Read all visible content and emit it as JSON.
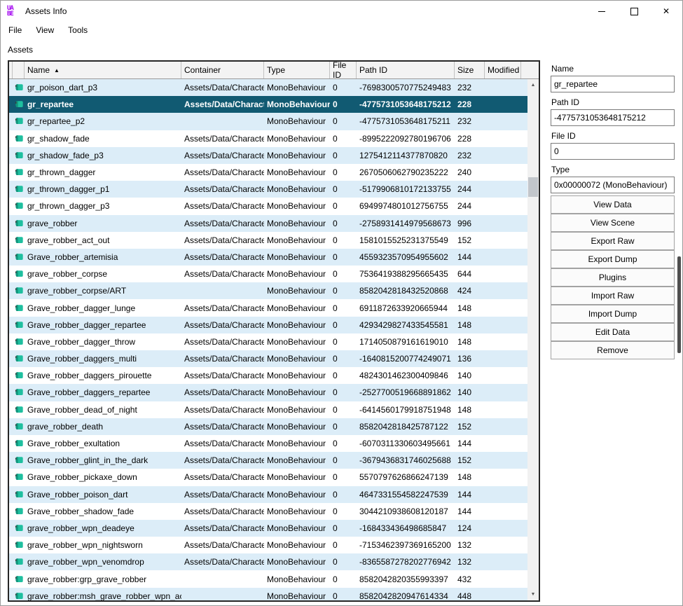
{
  "window": {
    "title": "Assets Info",
    "logo_line1": "UA",
    "logo_line2": "BE"
  },
  "menu": {
    "items": [
      "File",
      "View",
      "Tools"
    ]
  },
  "assets_label": "Assets",
  "icons": {
    "sort_asc": "▲",
    "scroll_up": "▲",
    "scroll_down": "▼",
    "close": "✕"
  },
  "colors": {
    "selected_row": "#115a72",
    "alt_row": "#dcedf8",
    "icon_teal": "#1fbf9f",
    "icon_teal_dark": "#11947c",
    "logo_purple": "#a100f0"
  },
  "table": {
    "columns": [
      "",
      "Name",
      "Container",
      "Type",
      "File ID",
      "Path ID",
      "Size",
      "Modified"
    ],
    "rows": [
      {
        "name": "gr_poison_dart_p3",
        "container": "Assets/Data/Characte",
        "type": "MonoBehaviour",
        "file_id": "0",
        "path_id": "-7698300570775249483",
        "size": "232",
        "modified": ""
      },
      {
        "name": "gr_repartee",
        "container": "Assets/Data/Characte",
        "type": "MonoBehaviour",
        "file_id": "0",
        "path_id": "-4775731053648175212",
        "size": "228",
        "modified": "",
        "selected": true
      },
      {
        "name": "gr_repartee_p2",
        "container": "",
        "type": "MonoBehaviour",
        "file_id": "0",
        "path_id": "-4775731053648175211",
        "size": "232",
        "modified": ""
      },
      {
        "name": "gr_shadow_fade",
        "container": "Assets/Data/Characte",
        "type": "MonoBehaviour",
        "file_id": "0",
        "path_id": "-8995222092780196706",
        "size": "228",
        "modified": ""
      },
      {
        "name": "gr_shadow_fade_p3",
        "container": "Assets/Data/Characte",
        "type": "MonoBehaviour",
        "file_id": "0",
        "path_id": "1275412114377870820",
        "size": "232",
        "modified": ""
      },
      {
        "name": "gr_thrown_dagger",
        "container": "Assets/Data/Characte",
        "type": "MonoBehaviour",
        "file_id": "0",
        "path_id": "2670506062790235222",
        "size": "240",
        "modified": ""
      },
      {
        "name": "gr_thrown_dagger_p1",
        "container": "Assets/Data/Characte",
        "type": "MonoBehaviour",
        "file_id": "0",
        "path_id": "-5179906810172133755",
        "size": "244",
        "modified": ""
      },
      {
        "name": "gr_thrown_dagger_p3",
        "container": "Assets/Data/Characte",
        "type": "MonoBehaviour",
        "file_id": "0",
        "path_id": "6949974801012756755",
        "size": "244",
        "modified": ""
      },
      {
        "name": "grave_robber",
        "container": "Assets/Data/Characte",
        "type": "MonoBehaviour",
        "file_id": "0",
        "path_id": "-2758931414979568673",
        "size": "996",
        "modified": ""
      },
      {
        "name": "grave_robber_act_out",
        "container": "Assets/Data/Characte",
        "type": "MonoBehaviour",
        "file_id": "0",
        "path_id": "1581015525231375549",
        "size": "152",
        "modified": ""
      },
      {
        "name": "Grave_robber_artemisia",
        "container": "Assets/Data/Characte",
        "type": "MonoBehaviour",
        "file_id": "0",
        "path_id": "4559323570954955602",
        "size": "144",
        "modified": ""
      },
      {
        "name": "grave_robber_corpse",
        "container": "Assets/Data/Characte",
        "type": "MonoBehaviour",
        "file_id": "0",
        "path_id": "7536419388295665435",
        "size": "644",
        "modified": ""
      },
      {
        "name": "grave_robber_corpse/ART",
        "container": "",
        "type": "MonoBehaviour",
        "file_id": "0",
        "path_id": "8582042818432520868",
        "size": "424",
        "modified": ""
      },
      {
        "name": "Grave_robber_dagger_lunge",
        "container": "Assets/Data/Characte",
        "type": "MonoBehaviour",
        "file_id": "0",
        "path_id": "6911872633920665944",
        "size": "148",
        "modified": ""
      },
      {
        "name": "Grave_robber_dagger_repartee",
        "container": "Assets/Data/Characte",
        "type": "MonoBehaviour",
        "file_id": "0",
        "path_id": "4293429827433545581",
        "size": "148",
        "modified": ""
      },
      {
        "name": "Grave_robber_dagger_throw",
        "container": "Assets/Data/Characte",
        "type": "MonoBehaviour",
        "file_id": "0",
        "path_id": "1714050879161619010",
        "size": "148",
        "modified": ""
      },
      {
        "name": "Grave_robber_daggers_multi",
        "container": "Assets/Data/Characte",
        "type": "MonoBehaviour",
        "file_id": "0",
        "path_id": "-1640815200774249071",
        "size": "136",
        "modified": ""
      },
      {
        "name": "Grave_robber_daggers_pirouette",
        "container": "Assets/Data/Characte",
        "type": "MonoBehaviour",
        "file_id": "0",
        "path_id": "4824301462300409846",
        "size": "140",
        "modified": ""
      },
      {
        "name": "Grave_robber_daggers_repartee",
        "container": "Assets/Data/Characte",
        "type": "MonoBehaviour",
        "file_id": "0",
        "path_id": "-2527700519668891862",
        "size": "140",
        "modified": ""
      },
      {
        "name": "Grave_robber_dead_of_night",
        "container": "Assets/Data/Characte",
        "type": "MonoBehaviour",
        "file_id": "0",
        "path_id": "-6414560179918751948",
        "size": "148",
        "modified": ""
      },
      {
        "name": "grave_robber_death",
        "container": "Assets/Data/Characte",
        "type": "MonoBehaviour",
        "file_id": "0",
        "path_id": "8582042818425787122",
        "size": "152",
        "modified": ""
      },
      {
        "name": "Grave_robber_exultation",
        "container": "Assets/Data/Characte",
        "type": "MonoBehaviour",
        "file_id": "0",
        "path_id": "-6070311330603495661",
        "size": "144",
        "modified": ""
      },
      {
        "name": "Grave_robber_glint_in_the_dark",
        "container": "Assets/Data/Characte",
        "type": "MonoBehaviour",
        "file_id": "0",
        "path_id": "-3679436831746025688",
        "size": "152",
        "modified": ""
      },
      {
        "name": "Grave_robber_pickaxe_down",
        "container": "Assets/Data/Characte",
        "type": "MonoBehaviour",
        "file_id": "0",
        "path_id": "5570797626866247139",
        "size": "148",
        "modified": ""
      },
      {
        "name": "Grave_robber_poison_dart",
        "container": "Assets/Data/Characte",
        "type": "MonoBehaviour",
        "file_id": "0",
        "path_id": "4647331554582247539",
        "size": "144",
        "modified": ""
      },
      {
        "name": "Grave_robber_shadow_fade",
        "container": "Assets/Data/Characte",
        "type": "MonoBehaviour",
        "file_id": "0",
        "path_id": "3044210938608120187",
        "size": "144",
        "modified": ""
      },
      {
        "name": "grave_robber_wpn_deadeye",
        "container": "Assets/Data/Characte",
        "type": "MonoBehaviour",
        "file_id": "0",
        "path_id": "-168433436498685847",
        "size": "124",
        "modified": ""
      },
      {
        "name": "grave_robber_wpn_nightsworn",
        "container": "Assets/Data/Characte",
        "type": "MonoBehaviour",
        "file_id": "0",
        "path_id": "-7153462397369165200",
        "size": "132",
        "modified": ""
      },
      {
        "name": "grave_robber_wpn_venomdrop",
        "container": "Assets/Data/Characte",
        "type": "MonoBehaviour",
        "file_id": "0",
        "path_id": "-8365587278202776942",
        "size": "132",
        "modified": ""
      },
      {
        "name": "grave_robber:grp_grave_robber",
        "container": "",
        "type": "MonoBehaviour",
        "file_id": "0",
        "path_id": "8582042820355993397",
        "size": "432",
        "modified": ""
      },
      {
        "name": "grave_robber:msh_grave_robber_wpn_ac",
        "container": "",
        "type": "MonoBehaviour",
        "file_id": "0",
        "path_id": "8582042820947614334",
        "size": "448",
        "modified": ""
      }
    ]
  },
  "panel": {
    "name_label": "Name",
    "name_value": "gr_repartee",
    "path_id_label": "Path ID",
    "path_id_value": "-4775731053648175212",
    "file_id_label": "File ID",
    "file_id_value": "0",
    "type_label": "Type",
    "type_value": "0x00000072 (MonoBehaviour)",
    "buttons": [
      "View Data",
      "View Scene",
      "Export Raw",
      "Export Dump",
      "Plugins",
      "Import Raw",
      "Import Dump",
      "Edit Data",
      "Remove"
    ]
  }
}
